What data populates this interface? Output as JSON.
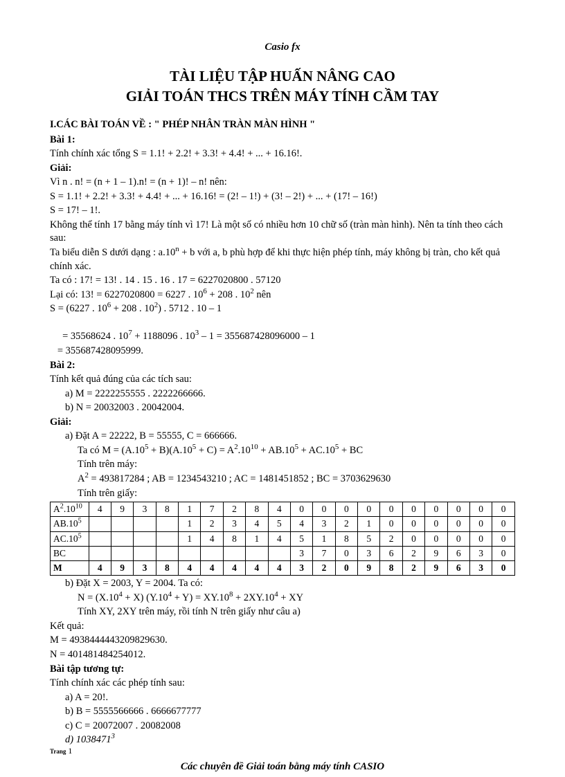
{
  "brand": "Casio fx",
  "title_line1": "TÀI LIỆU TẬP HUẤN NÂNG CAO",
  "title_line2": "GIẢI TOÁN THCS TRÊN MÁY TÍNH CẦM TAY",
  "section1_heading": "I.CÁC BÀI TOÁN VỀ : \" PHÉP NHÂN TRÀN MÀN HÌNH \"",
  "bai1": {
    "label": "Bài 1:",
    "line1": "Tính chính xác tổng S = 1.1! + 2.2! + 3.3! + 4.4! + ... + 16.16!.",
    "giai": "Giải:",
    "g1": "Vì n . n! = (n + 1 – 1).n! = (n + 1)! – n! nên:",
    "g2": "S = 1.1! + 2.2! + 3.3! + 4.4! + ... + 16.16! = (2! – 1!) + (3! – 2!) + ... + (17! – 16!)",
    "g3": "S = 17! – 1!.",
    "g4": "Không thể tính 17 bằng máy tính vì 17! Là một số có nhiều hơn 10 chữ số (tràn màn hình). Nên ta tính theo cách sau:",
    "g5a": "Ta biểu diễn S dưới dạng : a.10",
    "g5b": " + b với a, b phù hợp để khi thực hiện phép tính, máy không bị tràn, cho kết quả chính xác.",
    "g6": "Ta có : 17! = 13! . 14 . 15 . 16 . 17 = 6227020800 . 57120",
    "g7a": "Lại có: 13! = 6227020800 = 6227 . 10",
    "g7b": " + 208 . 10",
    "g7c": " nên",
    "g8a": "S = (6227 . 10",
    "g8b": " + 208 . 10",
    "g8c": ") . 5712 . 10 – 1",
    "g9a": "   = 35568624 . 10",
    "g9b": " + 1188096 . 10",
    "g9c": " – 1 = 355687428096000 – 1",
    "g10": "   = 355687428095999."
  },
  "bai2": {
    "label": "Bài 2:",
    "intro": "Tính kết quả đúng của các tích sau:",
    "a": "a)  M = 2222255555 . 2222266666.",
    "b": "b)  N =  20032003 . 20042004.",
    "giai": "Giải:",
    "sa1": "a)  Đặt A = 22222, B = 55555, C = 666666.",
    "sa2a": "Ta có M = (A.10",
    "sa2b": " + B)(A.10",
    "sa2c": " + C) = A",
    "sa2d": ".10",
    "sa2e": " + AB.10",
    "sa2f": " + AC.10",
    "sa2g": " + BC",
    "sa3": "Tính trên máy:",
    "sa4a": "A",
    "sa4b": " = 493817284 ; AB = 1234543210 ; AC = 1481451852 ; BC = 3703629630",
    "sa5": "Tính trên giấy:"
  },
  "table": {
    "rows": [
      {
        "head_a": "A",
        "head_sup": "2",
        "head_b": ".10",
        "head_sup2": "10",
        "cells": [
          "4",
          "9",
          "3",
          "8",
          "1",
          "7",
          "2",
          "8",
          "4",
          "0",
          "0",
          "0",
          "0",
          "0",
          "0",
          "0",
          "0",
          "0",
          "0"
        ]
      },
      {
        "head_a": "AB.10",
        "head_sup": "5",
        "head_b": "",
        "head_sup2": "",
        "cells": [
          "",
          "",
          "",
          "",
          "1",
          "2",
          "3",
          "4",
          "5",
          "4",
          "3",
          "2",
          "1",
          "0",
          "0",
          "0",
          "0",
          "0",
          "0"
        ]
      },
      {
        "head_a": "AC.10",
        "head_sup": "5",
        "head_b": "",
        "head_sup2": "",
        "cells": [
          "",
          "",
          "",
          "",
          "1",
          "4",
          "8",
          "1",
          "4",
          "5",
          "1",
          "8",
          "5",
          "2",
          "0",
          "0",
          "0",
          "0",
          "0"
        ]
      },
      {
        "head_a": "BC",
        "head_sup": "",
        "head_b": "",
        "head_sup2": "",
        "cells": [
          "",
          "",
          "",
          "",
          "",
          "",
          "",
          "",
          "",
          "3",
          "7",
          "0",
          "3",
          "6",
          "2",
          "9",
          "6",
          "3",
          "0"
        ]
      },
      {
        "head_a": "M",
        "head_sup": "",
        "head_b": "",
        "head_sup2": "",
        "cells": [
          "4",
          "9",
          "3",
          "8",
          "4",
          "4",
          "4",
          "4",
          "4",
          "3",
          "2",
          "0",
          "9",
          "8",
          "2",
          "9",
          "6",
          "3",
          "0"
        ],
        "bold": true
      }
    ]
  },
  "afterTable": {
    "b1": "b)  Đặt X = 2003, Y = 2004. Ta có:",
    "b2a": "N = (X.10",
    "b2b": " + X) (Y.10",
    "b2c": " + Y) = XY.10",
    "b2d": " + 2XY.10",
    "b2e": " + XY",
    "b3": "Tính XY, 2XY trên máy, rồi tính N trên giấy như câu a)",
    "kq": "Kết quả:",
    "m": "M = 4938444443209829630.",
    "n": "N = 401481484254012."
  },
  "btt": {
    "label": "Bài tập tương tự:",
    "intro": "Tính chính xác các phép tính sau:",
    "a": "a)  A = 20!.",
    "b": "b)  B =  5555566666 . 6666677777",
    "c": "c)  C = 20072007 . 20082008",
    "d_pre": "d)  1038471",
    "d_sup": "3"
  },
  "footer": "Các chuyên đề Giải toán bằng máy tính CASIO",
  "page_label": "Trang",
  "page_num": "1"
}
